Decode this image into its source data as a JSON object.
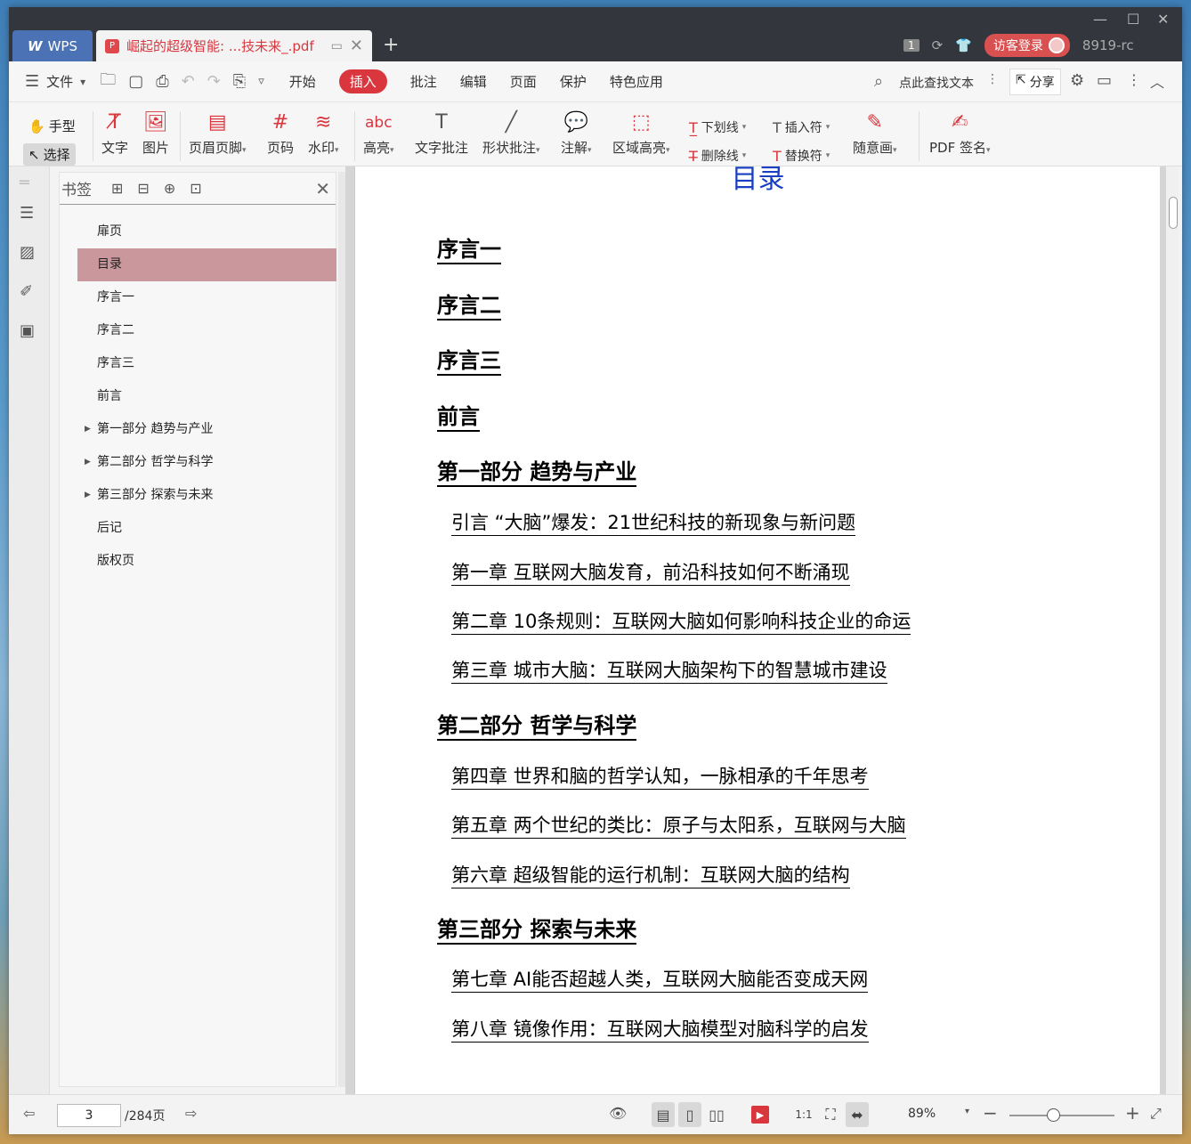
{
  "titlebar": {
    "app_tab": "WPS",
    "doc_tab_title": "崛起的超级智能: ...技未来_.pdf",
    "new_tab": "+",
    "page_badge": "1",
    "login": "访客登录",
    "user_id": "8919-rc"
  },
  "menubar": {
    "file": "文件",
    "items": [
      "开始",
      "插入",
      "批注",
      "编辑",
      "页面",
      "保护",
      "特色应用"
    ],
    "active_item": "插入",
    "search": "点此查找文本",
    "share": "分享"
  },
  "ribbon": {
    "hand": "手型",
    "select": "选择",
    "text": "文字",
    "image": "图片",
    "header_footer": "页眉页脚",
    "page_number": "页码",
    "watermark": "水印",
    "highlight": "高亮",
    "text_annot": "文字批注",
    "shape_annot": "形状批注",
    "note": "注解",
    "area_highlight": "区域高亮",
    "underline": "下划线",
    "strikethrough": "删除线",
    "insert_mark": "插入符",
    "replace_mark": "替换符",
    "freehand": "随意画",
    "pdf_sign": "PDF 签名"
  },
  "bookmarks": {
    "title": "书签",
    "items": [
      {
        "label": "扉页",
        "expandable": false
      },
      {
        "label": "目录",
        "expandable": false,
        "active": true
      },
      {
        "label": "序言一",
        "expandable": false
      },
      {
        "label": "序言二",
        "expandable": false
      },
      {
        "label": "序言三",
        "expandable": false
      },
      {
        "label": "前言",
        "expandable": false
      },
      {
        "label": "第一部分 趋势与产业",
        "expandable": true
      },
      {
        "label": "第二部分 哲学与科学",
        "expandable": true
      },
      {
        "label": "第三部分 探索与未来",
        "expandable": true
      },
      {
        "label": "后记",
        "expandable": false
      },
      {
        "label": "版权页",
        "expandable": false
      }
    ]
  },
  "document": {
    "toc_title": "目录",
    "entries": [
      {
        "text": "序言一",
        "level": 1
      },
      {
        "text": "序言二",
        "level": 1
      },
      {
        "text": "序言三",
        "level": 1
      },
      {
        "text": "前言",
        "level": 1
      },
      {
        "text": "第一部分 趋势与产业",
        "level": 1
      },
      {
        "text": "引言 “大脑”爆发：21世纪科技的新现象与新问题",
        "level": 2
      },
      {
        "text": "第一章 互联网大脑发育，前沿科技如何不断涌现",
        "level": 2
      },
      {
        "text": "第二章 10条规则：互联网大脑如何影响科技企业的命运",
        "level": 2
      },
      {
        "text": "第三章 城市大脑：互联网大脑架构下的智慧城市建设",
        "level": 2
      },
      {
        "text": "第二部分 哲学与科学",
        "level": 1
      },
      {
        "text": "第四章 世界和脑的哲学认知，一脉相承的千年思考",
        "level": 2
      },
      {
        "text": "第五章 两个世纪的类比：原子与太阳系，互联网与大脑",
        "level": 2
      },
      {
        "text": "第六章 超级智能的运行机制：互联网大脑的结构",
        "level": 2
      },
      {
        "text": "第三部分 探索与未来",
        "level": 1
      },
      {
        "text": "第七章 AI能否超越人类，互联网大脑能否变成天网",
        "level": 2
      },
      {
        "text": "第八章 镜像作用：互联网大脑模型对脑科学的启发",
        "level": 2
      }
    ]
  },
  "statusbar": {
    "current_page": "3",
    "total_pages": "/284页",
    "zoom": "89%"
  },
  "colors": {
    "accent": "#d9363e",
    "toc_title": "#1a3fc2",
    "bookmark_active": "#c9979c",
    "titlebar": "#33363d"
  }
}
